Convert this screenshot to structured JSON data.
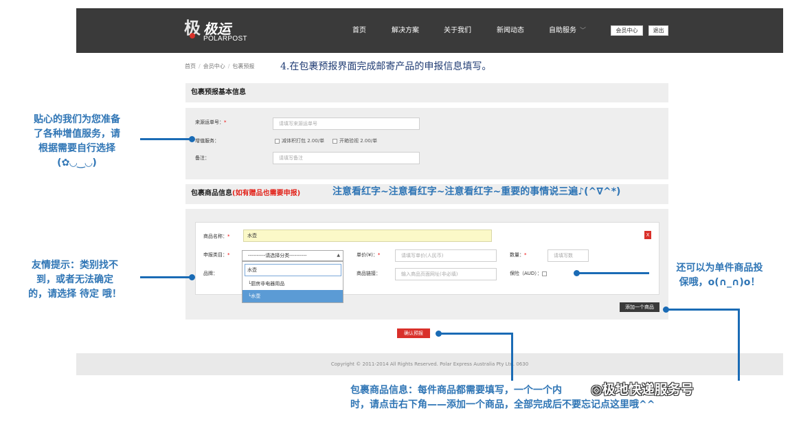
{
  "header": {
    "logo_glyph": "极",
    "logo_name": "极运",
    "logo_sub": "POLARPOST",
    "nav": [
      "首页",
      "解决方案",
      "关于我们",
      "新闻动态",
      "自助服务"
    ],
    "nav_chevron": "﹀",
    "member_center": "会员中心",
    "logout": "退出"
  },
  "breadcrumb": {
    "home": "首页",
    "sep": "/",
    "member": "会员中心",
    "current": "包裹预报"
  },
  "step_title": "4.在包裹预报界面完成邮寄产品的申报信息填写。",
  "basic": {
    "title": "包裹预报基本信息",
    "tracking_label": "来源运单号：",
    "req": "*",
    "tracking_placeholder": "请填写来源运单号",
    "service_label": "增值服务：",
    "service1": "减体积打包",
    "service1_price": "2.00/单",
    "service2": "开箱验视",
    "service2_price": "2.00/单",
    "remark_label": "备注：",
    "remark_placeholder": "请填写备注"
  },
  "goods": {
    "title": "包裹商品信息",
    "title_note": "(如有赠品也需要申报)",
    "name_label": "商品名称：",
    "name_value": "水壶",
    "category_label": "申报类目：",
    "category_value": "----------请选择分类----------",
    "dropdown_search": "水壶",
    "dropdown_group": "└厨房非电器用品",
    "dropdown_selected": "└水壶",
    "brand_label": "品牌：",
    "price_label": "单价(¥)：",
    "price_placeholder": "请填写单价(人民币)",
    "link_label": "商品链接：",
    "link_placeholder": "输入商品页面网址(非必填)",
    "qty_label": "数量：",
    "qty_placeholder": "请填写数",
    "insurance_label": "保险（AUD）：",
    "delete_label": "X",
    "add_label": "添加一个商品"
  },
  "confirm_label": "确认预报",
  "footer": "Copyright © 2011-2014 All Rights Reserved. Polar Express Australia Pty Ltd. 0630",
  "annotations": {
    "service_tip": [
      "贴心的我们为您准备",
      "了各种增值服务，请",
      "根据需要自行选择",
      "(✿◡‿◡)"
    ],
    "red_tip": "注意看红字~注意看红字~注意看红字~重要的事情说三遍♪(^∇^*)",
    "category_tip": [
      "友情提示：类别找不",
      "到，或者无法确定",
      "的，请选择 待定 哦！"
    ],
    "insurance_tip": [
      "还可以为单件商品投",
      "保哦，o(∩_∩)o！"
    ],
    "bottom_tip": [
      "包裹商品信息：每件商品都需要填写，一个",
      "时，请点击右下角——添加一个商品，全部完成后不要忘记点这里哦^^"
    ],
    "bottom_tip_covered": "一个内",
    "watermark": "极地快递服务号"
  },
  "colors": {
    "header_bg": "#3a3a3a",
    "annotation": "#2f75b5",
    "accent_red": "#d9302a",
    "highlight": "#fbf9c8"
  }
}
